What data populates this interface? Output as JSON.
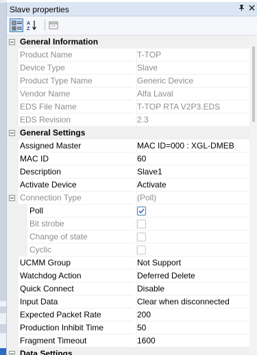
{
  "panel": {
    "title": "Slave properties",
    "pin_icon": "pin-icon",
    "close_icon": "close-icon"
  },
  "toolbar": {
    "categorized_icon": "categorized-view-icon",
    "alphabetical_icon": "alphabetical-sort-icon",
    "property_pages_icon": "property-pages-icon"
  },
  "sections": {
    "general_information": "General Information",
    "general_settings": "General Settings",
    "data_settings": "Data Settings"
  },
  "general_information": [
    {
      "name": "Product Name",
      "value": "T-TOP"
    },
    {
      "name": "Device Type",
      "value": "Slave"
    },
    {
      "name": "Product Type Name",
      "value": "Generic Device"
    },
    {
      "name": "Vendor Name",
      "value": "Alfa Laval"
    },
    {
      "name": "EDS File Name",
      "value": "T-TOP RTA V2P3.EDS"
    },
    {
      "name": "EDS Revision",
      "value": "2.3"
    }
  ],
  "general_settings": [
    {
      "name": "Assigned Master",
      "value": "MAC ID=000 : XGL-DMEB"
    },
    {
      "name": "MAC ID",
      "value": "60"
    },
    {
      "name": "Description",
      "value": "Slave1"
    },
    {
      "name": "Activate Device",
      "value": "Activate"
    },
    {
      "name": "Connection Type",
      "value": "(Poll)"
    },
    {
      "name": "Poll",
      "value": true
    },
    {
      "name": "Bit strobe",
      "value": false
    },
    {
      "name": "Change of state",
      "value": false
    },
    {
      "name": "Cyclic",
      "value": false
    },
    {
      "name": "UCMM Group",
      "value": "Not Support"
    },
    {
      "name": "Watchdog Action",
      "value": "Deferred Delete"
    },
    {
      "name": "Quick Connect",
      "value": "Disable"
    },
    {
      "name": "Input Data",
      "value": "Clear when disconnected"
    },
    {
      "name": "Expected Packet Rate",
      "value": "200"
    },
    {
      "name": "Production Inhibit Time",
      "value": "50"
    },
    {
      "name": "Fragment Timeout",
      "value": "1600"
    }
  ],
  "colors": {
    "title_bar": "#dbe6f4",
    "category_bg": "#f0f0f0",
    "disabled_text": "#8d8d8d",
    "accent": "#3c7fb1"
  }
}
